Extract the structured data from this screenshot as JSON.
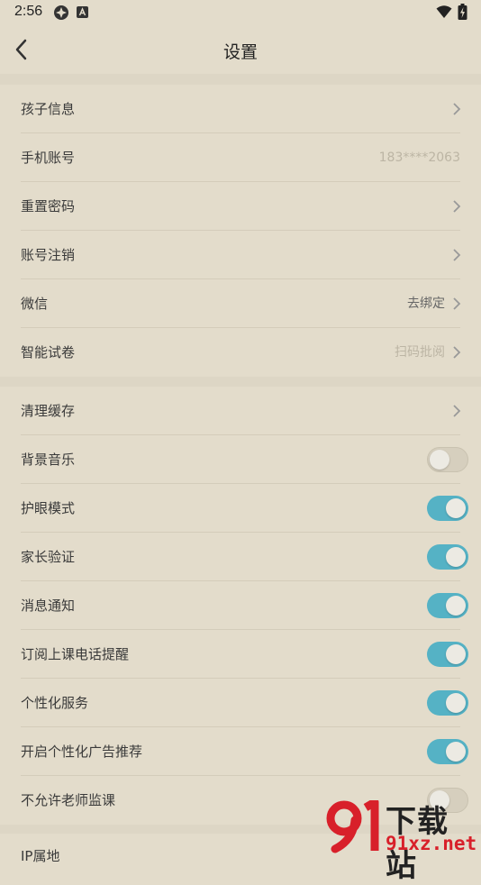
{
  "status_bar": {
    "time": "2:56"
  },
  "nav": {
    "title": "设置"
  },
  "group1": [
    {
      "label": "孩子信息",
      "value": "",
      "chevron": true
    },
    {
      "label": "手机账号",
      "value": "183****2063",
      "chevron": false
    },
    {
      "label": "重置密码",
      "value": "",
      "chevron": true
    },
    {
      "label": "账号注销",
      "value": "",
      "chevron": true
    },
    {
      "label": "微信",
      "value": "去绑定",
      "chevron": true
    },
    {
      "label": "智能试卷",
      "value": "扫码批阅",
      "chevron": true
    }
  ],
  "group2": [
    {
      "label": "清理缓存",
      "chevron": true
    },
    {
      "label": "背景音乐",
      "toggle": false
    },
    {
      "label": "护眼模式",
      "toggle": true
    },
    {
      "label": "家长验证",
      "toggle": true
    },
    {
      "label": "消息通知",
      "toggle": true
    },
    {
      "label": "订阅上课电话提醒",
      "toggle": true
    },
    {
      "label": "个性化服务",
      "toggle": true
    },
    {
      "label": "开启个性化广告推荐",
      "toggle": true
    },
    {
      "label": "不允许老师监课",
      "toggle": false
    }
  ],
  "group3": [
    {
      "label": "IP属地"
    }
  ],
  "watermark": {
    "brand": "下载站",
    "domain": "91xz.net"
  },
  "colors": {
    "background": "#e3dccb",
    "toggle_on": "#55b2c5",
    "toggle_off": "#d6cfbe",
    "watermark_red": "#d8202a"
  }
}
